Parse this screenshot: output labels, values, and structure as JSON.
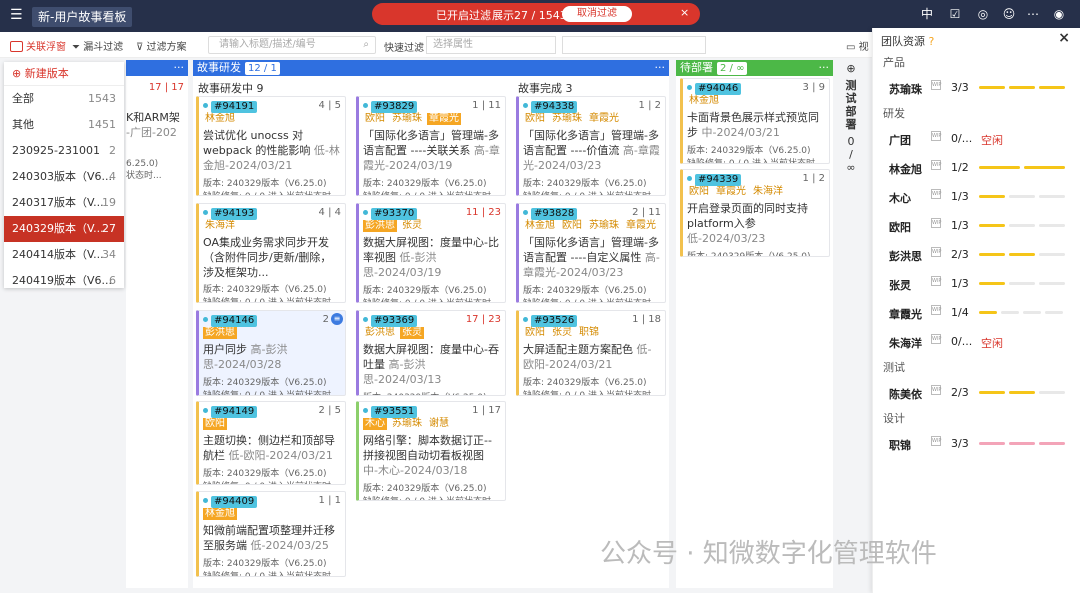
{
  "header": {
    "menu_icon": "menu-icon",
    "title": "新-用户故事看板",
    "filter_on": "已开启过滤",
    "filter_count": "展示27 / 1543",
    "cancel_filter": "取消过滤",
    "filter_close": "×",
    "lang": "中"
  },
  "toolbar": {
    "link_float": "关联浮窗",
    "funnel_filter": "漏斗过滤",
    "filter_plan": "过滤方案",
    "search_placeholder": "请输入标题/描述/编号",
    "quick_filter": "快速过滤",
    "attr_placeholder": "选择属性"
  },
  "versions": {
    "new_label": "新建版本",
    "items": [
      {
        "label": "全部",
        "count": "1543"
      },
      {
        "label": "其他",
        "count": "1451"
      },
      {
        "label": "230925-231001",
        "count": "2"
      },
      {
        "label": "240303版本（V6...",
        "count": "4"
      },
      {
        "label": "240317版本（V...",
        "count": "19"
      },
      {
        "label": "240329版本（V...",
        "count": "27"
      },
      {
        "label": "240414版本（V...",
        "count": "34"
      },
      {
        "label": "240419版本（V6...",
        "count": "6"
      }
    ]
  },
  "hidden_col": {
    "count": "17 | 17",
    "peek1": "K和ARM架",
    "peek2": "-广团-202",
    "peek3": "6.25.0)",
    "peek4": "状态时..."
  },
  "columns": {
    "dev": {
      "name": "故事研发",
      "badge": "12 / 1",
      "more": "···",
      "color": "#2f6fe0"
    },
    "dev_doing": "故事研发中 9",
    "dev_done": "故事完成 3",
    "deploy": {
      "name": "待部署",
      "badge": "2 / ∞",
      "more": "···",
      "color": "#4cb847"
    },
    "side_label": "测试部署",
    "side_count": "0 / ∞",
    "side_hint": "视"
  },
  "cards": {
    "c1": {
      "id": "#94191",
      "count": "4 | 5",
      "tags": [
        "林金旭"
      ],
      "title": "尝试优化 unocss 对 webpack 的性能影响",
      "meta": " 低-林金旭-2024/03/21"
    },
    "c2": {
      "id": "#94193",
      "count": "4 | 4",
      "tags": [
        "朱海洋"
      ],
      "title": "OA集成业务需求同步开发（含附件同步/更新/删除，涉及框架功...",
      "meta": ""
    },
    "c3": {
      "id": "#94146",
      "count": "2",
      "tags": [
        "彭洪思"
      ],
      "title": "用户同步",
      "meta": " 高-彭洪思-2024/03/28"
    },
    "c4": {
      "id": "#94149",
      "count": "2 | 5",
      "tags": [
        "欧阳"
      ],
      "title": "主题切换：侧边栏和顶部导航栏",
      "meta": " 低-欧阳-2024/03/21"
    },
    "c5": {
      "id": "#94409",
      "count": "1 | 1",
      "tags": [
        "林金旭"
      ],
      "title": "知微前端配置项整理并迁移至服务端",
      "meta": " 低-2024/03/25"
    },
    "c6": {
      "id": "#93829",
      "count": "1 | 11",
      "tags": [
        "欧阳",
        "苏瑜珠",
        "章霞光"
      ],
      "title": "「国际化多语言」管理端-多语言配置 ----关联关系",
      "meta": " 高-章霞光-2024/03/19"
    },
    "c7": {
      "id": "#93370",
      "count": "11 | 23",
      "tags": [
        "彭洪思",
        "张灵"
      ],
      "title": "数据大屏视图：度量中心-比率视图",
      "meta": " 低-彭洪思-2024/03/19"
    },
    "c8": {
      "id": "#93369",
      "count": "17 | 23",
      "tags": [
        "彭洪思",
        "张灵"
      ],
      "title": "数据大屏视图：度量中心-吞吐量",
      "meta": " 高-彭洪思-2024/03/13"
    },
    "c9": {
      "id": "#93551",
      "count": "1 | 17",
      "tags": [
        "木心",
        "苏瑜珠",
        "谢慧"
      ],
      "title": "网络引擎：脚本数据订正--拼接视图自动切看板视图",
      "meta": " 中-木心-2024/03/18"
    },
    "c10": {
      "id": "#94338",
      "count": "1 | 2",
      "tags": [
        "欧阳",
        "苏瑜珠",
        "章霞光"
      ],
      "title": "「国际化多语言」管理端-多语言配置 ----价值流",
      "meta": " 高-章霞光-2024/03/23"
    },
    "c11": {
      "id": "#93828",
      "count": "2 | 11",
      "tags": [
        "林金旭",
        "欧阳",
        "苏瑜珠",
        "章霞光"
      ],
      "title": "「国际化多语言」管理端-多语言配置 ----自定义属性",
      "meta": " 高-章霞光-2024/03/23"
    },
    "c12": {
      "id": "#93526",
      "count": "1 | 18",
      "tags": [
        "欧阳",
        "张灵",
        "职锦"
      ],
      "title": "大屏适配主题方案配色",
      "meta": " 低-欧阳-2024/03/21"
    },
    "c13": {
      "id": "#94046",
      "count": "3 | 9",
      "tags": [
        "林金旭"
      ],
      "title": "卡面背景色展示样式预览同步",
      "meta": " 中-2024/03/21"
    },
    "c14": {
      "id": "#94339",
      "count": "1 | 2",
      "tags": [
        "欧阳",
        "章霞光",
        "朱海洋"
      ],
      "title": "开启登录页面的同时支持platform入参",
      "meta": " 低-2024/03/23"
    },
    "ver_line": "版本: 240329版本（V6.25.0)",
    "state_line": "缺陷修复: 0 / 0      进入当前状态时..."
  },
  "resources": {
    "title": "团队资源",
    "close": "×",
    "groups": [
      {
        "label": "产品",
        "members": [
          {
            "name": "苏瑜珠",
            "load": "3/3",
            "bars": 3,
            "color": "#f5c518"
          }
        ]
      },
      {
        "label": "研发",
        "members": [
          {
            "name": "广团",
            "load": "0/...",
            "free": "空闲",
            "bars": 0,
            "color": "#f5c518"
          },
          {
            "name": "林金旭",
            "load": "1/2",
            "bars": 2,
            "color": "#f5c518"
          },
          {
            "name": "木心",
            "load": "1/3",
            "bars": 1,
            "color": "#f5c518"
          },
          {
            "name": "欧阳",
            "load": "1/3",
            "bars": 1,
            "color": "#f5c518"
          },
          {
            "name": "彭洪思",
            "load": "2/3",
            "bars": 2,
            "color": "#f5c518"
          },
          {
            "name": "张灵",
            "load": "1/3",
            "bars": 1,
            "color": "#f5c518"
          },
          {
            "name": "章霞光",
            "load": "1/4",
            "bars": 1,
            "color": "#f5c518"
          },
          {
            "name": "朱海洋",
            "load": "0/...",
            "free": "空闲",
            "bars": 0,
            "color": "#f5c518"
          }
        ]
      },
      {
        "label": "测试",
        "members": [
          {
            "name": "陈美依",
            "load": "2/3",
            "bars": 2,
            "color": "#f5c518"
          }
        ]
      },
      {
        "label": "设计",
        "members": [
          {
            "name": "职锦",
            "load": "3/3",
            "bars": 3,
            "color": "#f3a4b8"
          }
        ]
      }
    ]
  },
  "watermark": "公众号 · 知微数字化管理软件"
}
